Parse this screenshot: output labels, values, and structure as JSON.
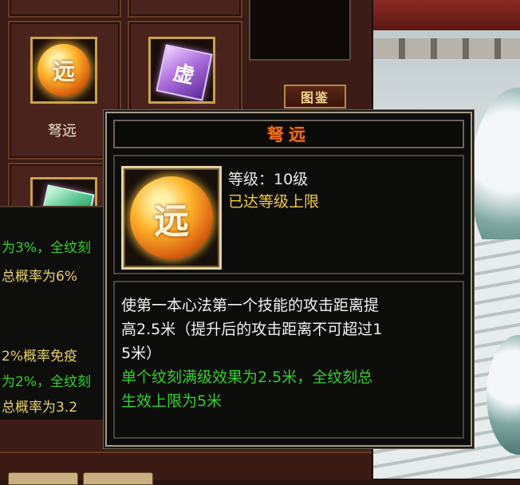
{
  "inventory": {
    "slot_label": "弩远",
    "coin_glyph": "远",
    "gem_glyph": "虚",
    "button_tujian": "图鉴"
  },
  "side_list": {
    "lines": [
      {
        "text": "为3%，全纹刻",
        "color": "green"
      },
      {
        "text": "总概率为6%",
        "color": "yellow"
      },
      {
        "text": "2%概率免疫",
        "color": "yellow"
      },
      {
        "text": "为2%，全纹刻",
        "color": "green"
      },
      {
        "text": "总概率为3.2",
        "color": "yellow"
      }
    ]
  },
  "tooltip": {
    "title": "弩远",
    "level": "等级：10级",
    "max_level": "已达等级上限",
    "desc_line1": "使第一本心法第一个技能的攻击距离提",
    "desc_line2": "高2.5米（提升后的攻击距离不可超过1",
    "desc_line3": "5米）",
    "effect_line1": "单个纹刻满级效果为2.5米，全纹刻总",
    "effect_line2": "生效上限为5米"
  },
  "colors": {
    "title_orange": "#f07018",
    "max_gold": "#f3cc3c",
    "effect_green": "#33d12b"
  }
}
